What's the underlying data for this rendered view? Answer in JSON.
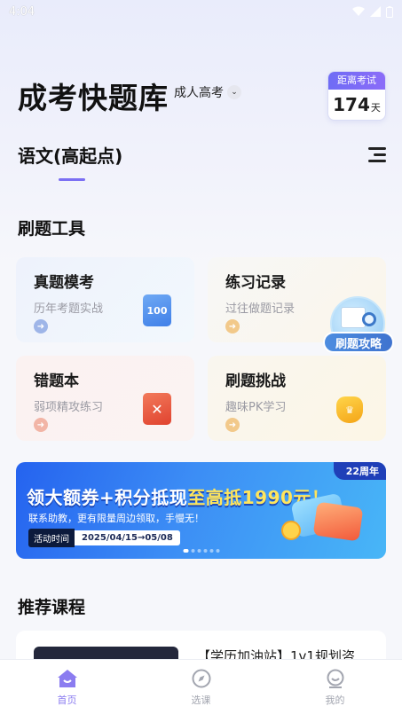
{
  "status_bar": {
    "time": "4:04"
  },
  "header": {
    "app_title": "成考快题库",
    "level": "成人高考",
    "countdown_label": "距离考试",
    "countdown_value": "174",
    "countdown_unit": "天"
  },
  "subject": {
    "label": "语文(高起点)"
  },
  "tools": {
    "title": "刷题工具",
    "items": [
      {
        "title": "真题模考",
        "subtitle": "历年考题实战",
        "icon_text": "100"
      },
      {
        "title": "练习记录",
        "subtitle": "过往做题记录"
      },
      {
        "title": "错题本",
        "subtitle": "弱项精攻练习"
      },
      {
        "title": "刷题挑战",
        "subtitle": "趣味PK学习"
      }
    ]
  },
  "float_badge": {
    "label": "刷题攻略"
  },
  "banner": {
    "anniversary": "22周年",
    "headline_main": "领大额券+积分抵现",
    "headline_highlight": "至高抵1990元！",
    "subline": "联系助教，更有限量周边领取，手慢无！",
    "time_tag": "活动时间",
    "time_range": "2025/04/15→05/08"
  },
  "courses": {
    "title": "推荐课程",
    "items": [
      {
        "title": "【学历加油站】1v1规划咨"
      }
    ]
  },
  "bottom_nav": [
    {
      "label": "首页",
      "icon": "home-icon"
    },
    {
      "label": "选课",
      "icon": "compass-icon"
    },
    {
      "label": "我的",
      "icon": "profile-icon"
    }
  ],
  "colors": {
    "accent": "#8b7cf0",
    "banner_blue": "#2563ef",
    "highlight_yellow": "#ffe55c"
  }
}
